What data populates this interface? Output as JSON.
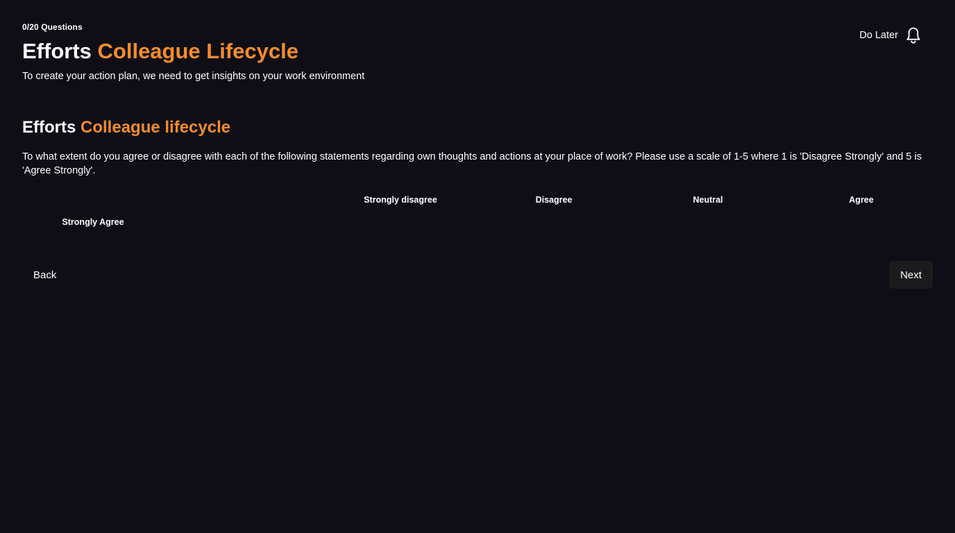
{
  "header": {
    "progress": "0/20 Questions",
    "title_prefix": "Efforts",
    "title_highlight": "Colleague Lifecycle",
    "subtitle": "To create your action plan, we need to get insights on your work environment",
    "do_later_label": "Do Later",
    "do_later_icon": "bell-icon"
  },
  "section": {
    "title_prefix": "Efforts",
    "title_highlight": "Colleague lifecycle",
    "question": "To what extent do you agree or disagree with each of the following statements regarding own thoughts and actions at your place of work? Please use a scale of 1-5 where 1 is 'Disagree Strongly' and 5 is 'Agree Strongly'."
  },
  "scale": {
    "labels": [
      "Strongly disagree",
      "Disagree",
      "Neutral",
      "Agree",
      "Strongly Agree"
    ]
  },
  "navigation": {
    "back_label": "Back",
    "next_label": "Next"
  },
  "colors": {
    "background": "#0f0e17",
    "accent": "#f48c2b",
    "next_button_bg": "#1b1b1e"
  }
}
